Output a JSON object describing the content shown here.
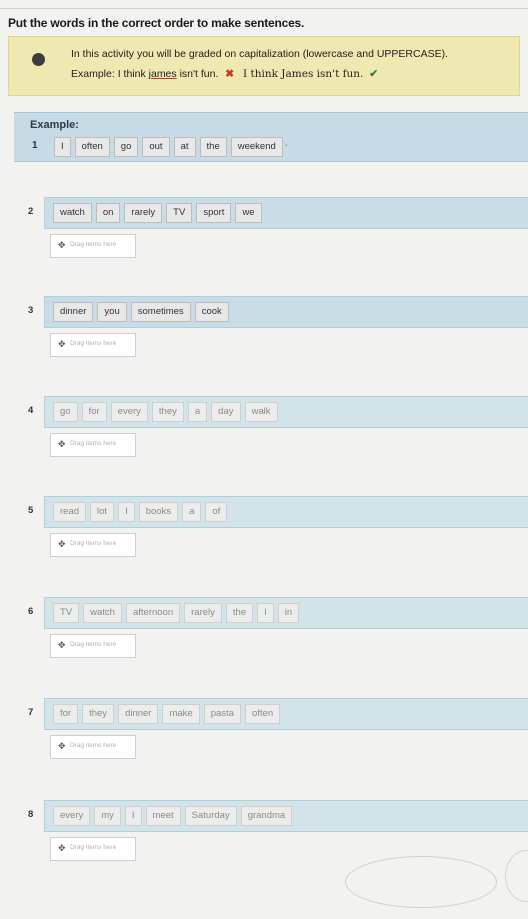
{
  "instruction": "Put the words in the correct order to make sentences.",
  "notice": {
    "line1": "In this activity you will be graded on capitalization (lowercase and UPPERCASE).",
    "example_prefix": "Example:",
    "example_wrong_start": "I think ",
    "example_wrong_name": "james",
    "example_wrong_end": " isn't fun.",
    "cross": "✖",
    "example_right": "I think James isn't fun.",
    "check": "✔"
  },
  "example": {
    "label": "Example:",
    "number": "1",
    "words": [
      "I",
      "often",
      "go",
      "out",
      "at",
      "the",
      "weekend"
    ],
    "arrow": "-"
  },
  "answer_placeholder": "Drag items here",
  "questions": [
    {
      "number": "2",
      "words": [
        "watch",
        "on",
        "rarely",
        "TV",
        "sport",
        "we"
      ]
    },
    {
      "number": "3",
      "words": [
        "dinner",
        "you",
        "sometimes",
        "cook"
      ]
    },
    {
      "number": "4",
      "words": [
        "go",
        "for",
        "every",
        "they",
        "a",
        "day",
        "walk"
      ]
    },
    {
      "number": "5",
      "words": [
        "read",
        "lot",
        "I",
        "books",
        "a",
        "of"
      ]
    },
    {
      "number": "6",
      "words": [
        "TV",
        "watch",
        "afternoon",
        "rarely",
        "the",
        "I",
        "in"
      ]
    },
    {
      "number": "7",
      "words": [
        "for",
        "they",
        "dinner",
        "make",
        "pasta",
        "often"
      ]
    },
    {
      "number": "8",
      "words": [
        "every",
        "my",
        "I",
        "meet",
        "Saturday",
        "grandma"
      ]
    }
  ]
}
